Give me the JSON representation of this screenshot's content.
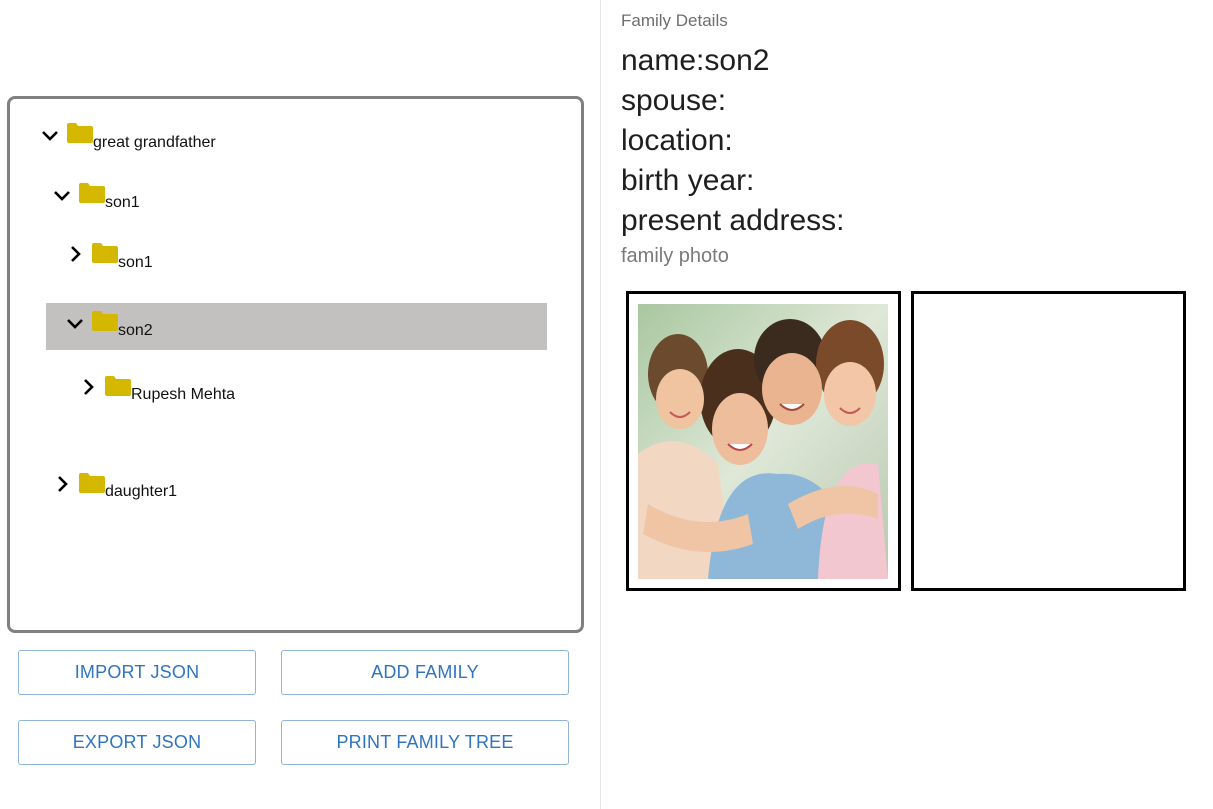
{
  "tree": {
    "nodes": [
      {
        "label": "great grandfather",
        "expanded": true,
        "selected": false
      },
      {
        "label": "son1",
        "expanded": true,
        "selected": false
      },
      {
        "label": "son1",
        "expanded": false,
        "selected": false
      },
      {
        "label": "son2",
        "expanded": true,
        "selected": true
      },
      {
        "label": "Rupesh Mehta",
        "expanded": false,
        "selected": false
      },
      {
        "label": "daughter1",
        "expanded": false,
        "selected": false
      }
    ]
  },
  "buttons": {
    "import_json": "IMPORT JSON",
    "add_family": "ADD FAMILY",
    "export_json": "EXPORT JSON",
    "print_tree": "PRINT FAMILY TREE"
  },
  "details": {
    "heading": "Family Details",
    "name_line": "name:son2",
    "spouse_line": "spouse:",
    "location_line": "location:",
    "birth_year_line": "birth year:",
    "present_address_line": "present address:",
    "photo_label": "family photo"
  },
  "colors": {
    "folder": "#d4b800",
    "selected_row": "#c3c0c0",
    "button_text": "#2f74c0",
    "button_border": "#8fb3da"
  }
}
